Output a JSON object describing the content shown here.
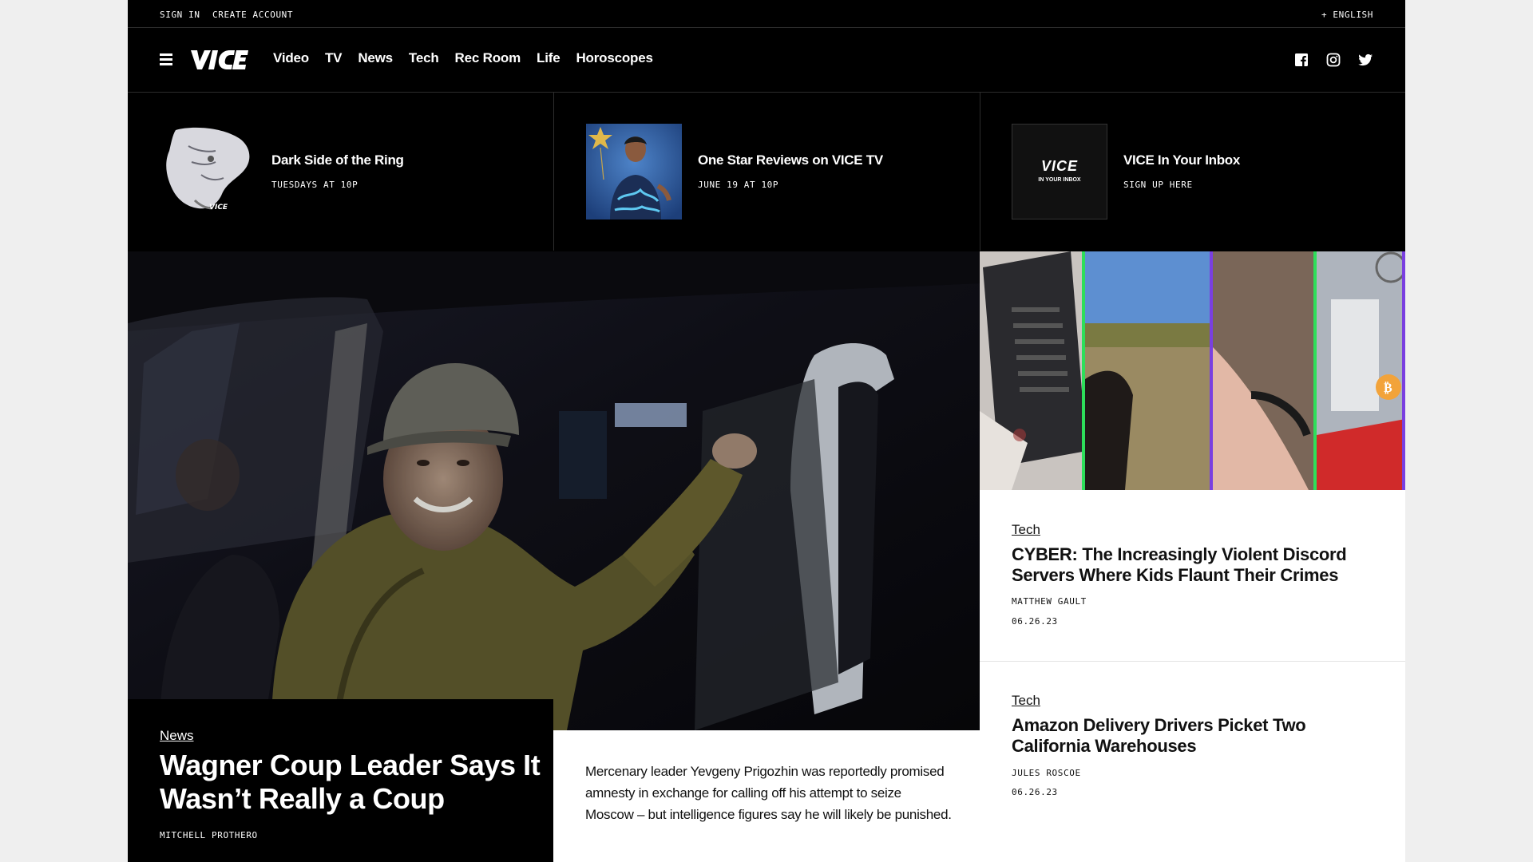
{
  "topbar": {
    "sign_in": "SIGN IN",
    "create_account": "CREATE ACCOUNT",
    "language": "+ ENGLISH"
  },
  "nav": {
    "logo_text": "VICE",
    "items": [
      {
        "label": "Video"
      },
      {
        "label": "TV"
      },
      {
        "label": "News"
      },
      {
        "label": "Tech"
      },
      {
        "label": "Rec Room"
      },
      {
        "label": "Life"
      },
      {
        "label": "Horoscopes"
      }
    ],
    "social_icons": [
      "facebook-icon",
      "instagram-icon",
      "twitter-icon"
    ]
  },
  "promos": [
    {
      "title": "Dark Side of the Ring",
      "subtitle": "TUESDAYS AT 10P"
    },
    {
      "title": "One Star Reviews on VICE TV",
      "subtitle": "JUNE 19 AT 10P"
    },
    {
      "title": "VICE In Your Inbox",
      "subtitle": "SIGN UP HERE",
      "thumb_logo": "VICE",
      "thumb_text": "IN YOUR INBOX"
    }
  ],
  "hero": {
    "category": "News",
    "headline": "Wagner Coup Leader Says It Wasn’t Really a Coup",
    "author": "MITCHELL PROTHERO",
    "description": "Mercenary leader Yevgeny Prigozhin was reportedly promised amnesty in exchange for calling off his attempt to seize Moscow – but intelligence figures say he will likely be punished."
  },
  "stories": [
    {
      "category": "Tech",
      "headline": "CYBER: The Increasingly Violent Discord Servers Where Kids Flaunt Their Crimes",
      "author": "MATTHEW GAULT",
      "date": "06.26.23"
    },
    {
      "category": "Tech",
      "headline": "Amazon Delivery Drivers Picket Two California Warehouses",
      "author": "JULES ROSCOE",
      "date": "06.26.23"
    }
  ],
  "colors": {
    "background": "#000000",
    "page_outer": "#efefef",
    "text_light": "#ffffff",
    "text_dark": "#111111",
    "divider": "#2d2d2d"
  }
}
